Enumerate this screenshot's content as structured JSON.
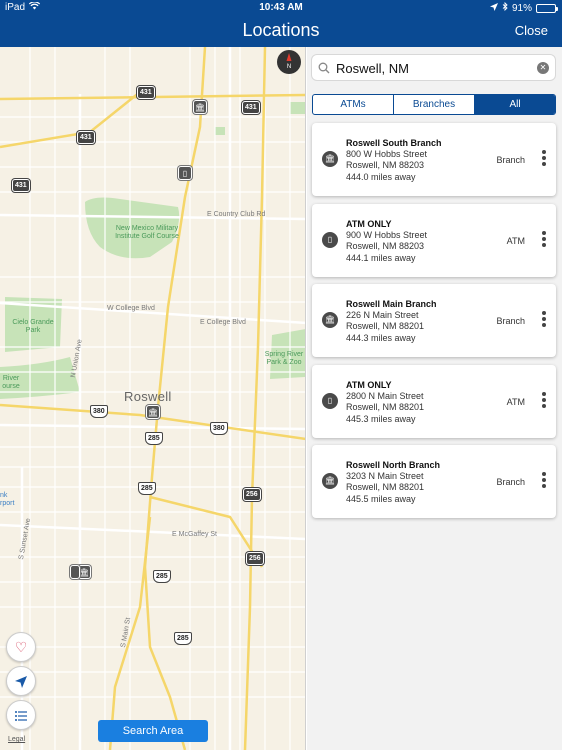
{
  "status_bar": {
    "device": "iPad",
    "time": "10:43 AM",
    "battery": "91%",
    "battery_level": 0.91
  },
  "nav": {
    "title": "Locations",
    "close_label": "Close"
  },
  "map": {
    "city": "Roswell",
    "streets": [
      "E Country Club Rd",
      "W College Blvd",
      "E College Blvd",
      "N Union Ave",
      "E McGaffey St",
      "S Sunset Ave",
      "S Main St"
    ],
    "parks": [
      "New Mexico Military Institute Golf Course",
      "Cielo Grande Park",
      "Spring River Park & Zoo",
      "River ourse"
    ],
    "airport_label": "nk\nrport",
    "shields": [
      "431",
      "431",
      "431",
      "431",
      "380",
      "285",
      "380",
      "285",
      "256",
      "256",
      "285",
      "285"
    ],
    "compass": "N",
    "legal": "Legal",
    "search_area_label": "Search Area"
  },
  "search": {
    "value": "Roswell, NM",
    "clear_icon": "clear-icon"
  },
  "filters": [
    {
      "label": "ATMs",
      "active": false
    },
    {
      "label": "Branches",
      "active": false
    },
    {
      "label": "All",
      "active": true
    }
  ],
  "locations": [
    {
      "name": "Roswell South Branch",
      "street": "800 W Hobbs Street",
      "city": "Roswell, NM 88203",
      "distance": "444.0 miles away",
      "type": "Branch",
      "icon": "bank-icon"
    },
    {
      "name": "ATM ONLY",
      "street": "900 W Hobbs Street",
      "city": "Roswell, NM  88203",
      "distance": "444.1 miles away",
      "type": "ATM",
      "icon": "atm-icon"
    },
    {
      "name": "Roswell Main Branch",
      "street": "226 N Main Street",
      "city": "Roswell, NM 88201",
      "distance": "444.3 miles away",
      "type": "Branch",
      "icon": "bank-icon"
    },
    {
      "name": "ATM ONLY",
      "street": "2800 N Main Street",
      "city": "Roswell, NM 88201",
      "distance": "445.3 miles away",
      "type": "ATM",
      "icon": "atm-icon"
    },
    {
      "name": "Roswell North Branch",
      "street": "3203 N Main Street",
      "city": "Roswell, NM 88201",
      "distance": "445.5 miles away",
      "type": "Branch",
      "icon": "bank-icon"
    }
  ],
  "colors": {
    "nav_bar": "#0a4a93",
    "accent": "#1a7fe0",
    "map_bg": "#f6f1e5"
  }
}
